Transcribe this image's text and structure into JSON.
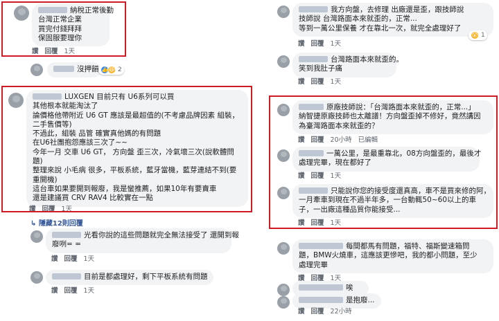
{
  "colors": {
    "highlight_box": "#d01a25",
    "bubble": "#f2f3f5",
    "link": "#385898"
  },
  "left": {
    "c1": {
      "lines": [
        "納稅正常後勤",
        "台灣正常企業",
        "買完付錢拜拜",
        "保固服要理你"
      ],
      "like": "讚",
      "reply": "回覆",
      "time": "1天"
    },
    "c2": {
      "text": "沒押韻",
      "reaction_count": "2"
    },
    "c3": {
      "lines": [
        "LUXGEN 目前只有 U6系列可以買",
        "其他根本就能淘汰了",
        "論價格他帶附近 U6 GT 應該是最超值的(不考慮品牌因素 組裝，",
        "二手售價等)",
        "不過此，組裝 品管 確實真他媽的有問題",
        "在U6社團抱怨應該三次了~~",
        "今年一月 交車 U6 GT， 方向盤 歪三次，冷氣壞三次(說軟體問",
        "題)",
        "整理來說 小毛病 很多，平板系統，藍牙當機，藍芽連結不到(要",
        "重開機)",
        "這台車如果要開到報廢，我是蠻推薦，如果10年有要賣車",
        "還是建議買 CRV RAV4 比較實在一點"
      ],
      "like": "讚",
      "reply": "回覆",
      "time": "1天"
    },
    "hidden_replies": "隱藏12則回覆",
    "c4": {
      "lines": [
        "光看你說的這些問題就完全無法接受了 還開到報",
        "廢咧= ="
      ],
      "like": "讚",
      "reply": "回覆",
      "time": "1天"
    },
    "c5": {
      "text": "目前是都處理好，剩下平板系統有問題",
      "like": "讚",
      "reply": "回覆",
      "time": "1天"
    }
  },
  "right": {
    "r1": {
      "lines": [
        "我方向盤，去修理 出廠還是歪，跟技師說",
        "技師說 台灣路面本來就歪的，正常...",
        "等到一萬公里保養 才在靠北一次，就完全處理好了"
      ],
      "like": "讚",
      "reply": "回覆",
      "time": "1天",
      "reaction": "😮",
      "reaction_count": "1"
    },
    "r2": {
      "lines": [
        "台灣路面本來就歪的。",
        "笑到我肚子痛"
      ],
      "like": "讚",
      "reply": "回覆",
      "time": "1天"
    },
    "r3": {
      "lines": [
        "原廠技師說：「台灣路面本來就歪的，正常...」",
        "納智捷原廠技師也太離譜！方向盤歪掉不修好，竟然講因",
        "為臺灣路面本來就歪的？"
      ],
      "like": "讚",
      "reply": "回覆",
      "time": "20小時",
      "edited": "已編輯"
    },
    "r4": {
      "lines": [
        "一萬公里，是最重靠北，08方向盤歪的，最後才",
        "處理完畢，現在都好了"
      ],
      "like": "讚",
      "reply": "回覆",
      "time": "1天"
    },
    "r5": {
      "lines": [
        "只能說你您的接受度還真高，車不是買來修的阿，",
        "一月牽車到現在不過半年多，一台動輒50~60以上的車",
        "子，一出廠這種品質你能接受..."
      ],
      "like": "讚",
      "reply": "回覆",
      "time": "1天"
    },
    "r6": {
      "lines": [
        "每間都馬有問題，福特、福斯變速箱問",
        "題，BMW火燒車，這應該更慘吧，我的都小問題，至少",
        "處理完畢"
      ],
      "like": "讚",
      "reply": "回覆",
      "time": "1天"
    },
    "r7": {
      "text": "唉",
      "like": "讚",
      "reply": "回覆",
      "time": "23小時"
    },
    "r8": {
      "text": "是抱廢...",
      "like": "讚",
      "reply": "回覆",
      "time": "22小時"
    }
  }
}
